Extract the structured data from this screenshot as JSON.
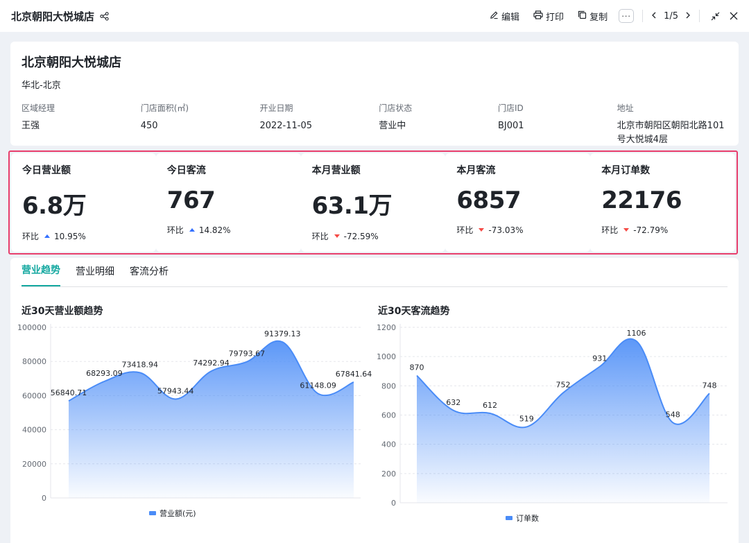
{
  "header": {
    "title": "北京朝阳大悦城店",
    "edit_label": "编辑",
    "print_label": "打印",
    "copy_label": "复制",
    "more_label": "···",
    "pager": "1/5"
  },
  "store": {
    "name": "北京朝阳大悦城店",
    "region": "华北-北京",
    "fields": [
      {
        "label": "区域经理",
        "value": "王强"
      },
      {
        "label": "门店面积(㎡)",
        "value": "450"
      },
      {
        "label": "开业日期",
        "value": "2022-11-05"
      },
      {
        "label": "门店状态",
        "value": "营业中"
      },
      {
        "label": "门店ID",
        "value": "BJ001"
      },
      {
        "label": "地址",
        "value": "北京市朝阳区朝阳北路101号大悦城4层"
      }
    ]
  },
  "kpis": [
    {
      "title": "今日营业额",
      "value": "6.8万",
      "cmp_label": "环比",
      "change": "10.95%",
      "direction": "up"
    },
    {
      "title": "今日客流",
      "value": "767",
      "cmp_label": "环比",
      "change": "14.82%",
      "direction": "up"
    },
    {
      "title": "本月营业额",
      "value": "63.1万",
      "cmp_label": "环比",
      "change": "-72.59%",
      "direction": "down"
    },
    {
      "title": "本月客流",
      "value": "6857",
      "cmp_label": "环比",
      "change": "-73.03%",
      "direction": "down"
    },
    {
      "title": "本月订单数",
      "value": "22176",
      "cmp_label": "环比",
      "change": "-72.79%",
      "direction": "down"
    }
  ],
  "tabs": [
    {
      "label": "营业趋势",
      "active": true
    },
    {
      "label": "营业明细",
      "active": false
    },
    {
      "label": "客流分析",
      "active": false
    }
  ],
  "colors": {
    "accent": "#14a8a0",
    "series": "#4a8cf7",
    "up": "#3370ff",
    "down": "#f54a45",
    "highlight": "#e83e6c"
  },
  "chart_data": [
    {
      "type": "area",
      "title": "近30天营业额趋势",
      "series": [
        {
          "name": "营业额(元)",
          "values": [
            56840.71,
            68293.09,
            73418.94,
            57943.44,
            74292.94,
            79793.67,
            91379.13,
            61148.09,
            67841.64
          ]
        }
      ],
      "data_labels": [
        "56840.71",
        "68293.09",
        "73418.94",
        "57943.44",
        "74292.94",
        "79793.67",
        "91379.13",
        "61148.09",
        "67841.64"
      ],
      "yticks": [
        "0",
        "20000",
        "40000",
        "60000",
        "80000",
        "100000"
      ],
      "ylim": [
        0,
        100000
      ],
      "grid": true,
      "legend": "bottom-center"
    },
    {
      "type": "area",
      "title": "近30天客流趋势",
      "series": [
        {
          "name": "订单数",
          "values": [
            870,
            632,
            612,
            519,
            752,
            931,
            1106,
            548,
            748
          ]
        }
      ],
      "data_labels": [
        "870",
        "632",
        "612",
        "519",
        "752",
        "931",
        "1106",
        "548",
        "748"
      ],
      "yticks": [
        "0",
        "200",
        "400",
        "600",
        "800",
        "1000",
        "1200"
      ],
      "ylim": [
        0,
        1200
      ],
      "grid": true,
      "legend": "bottom-center"
    }
  ]
}
